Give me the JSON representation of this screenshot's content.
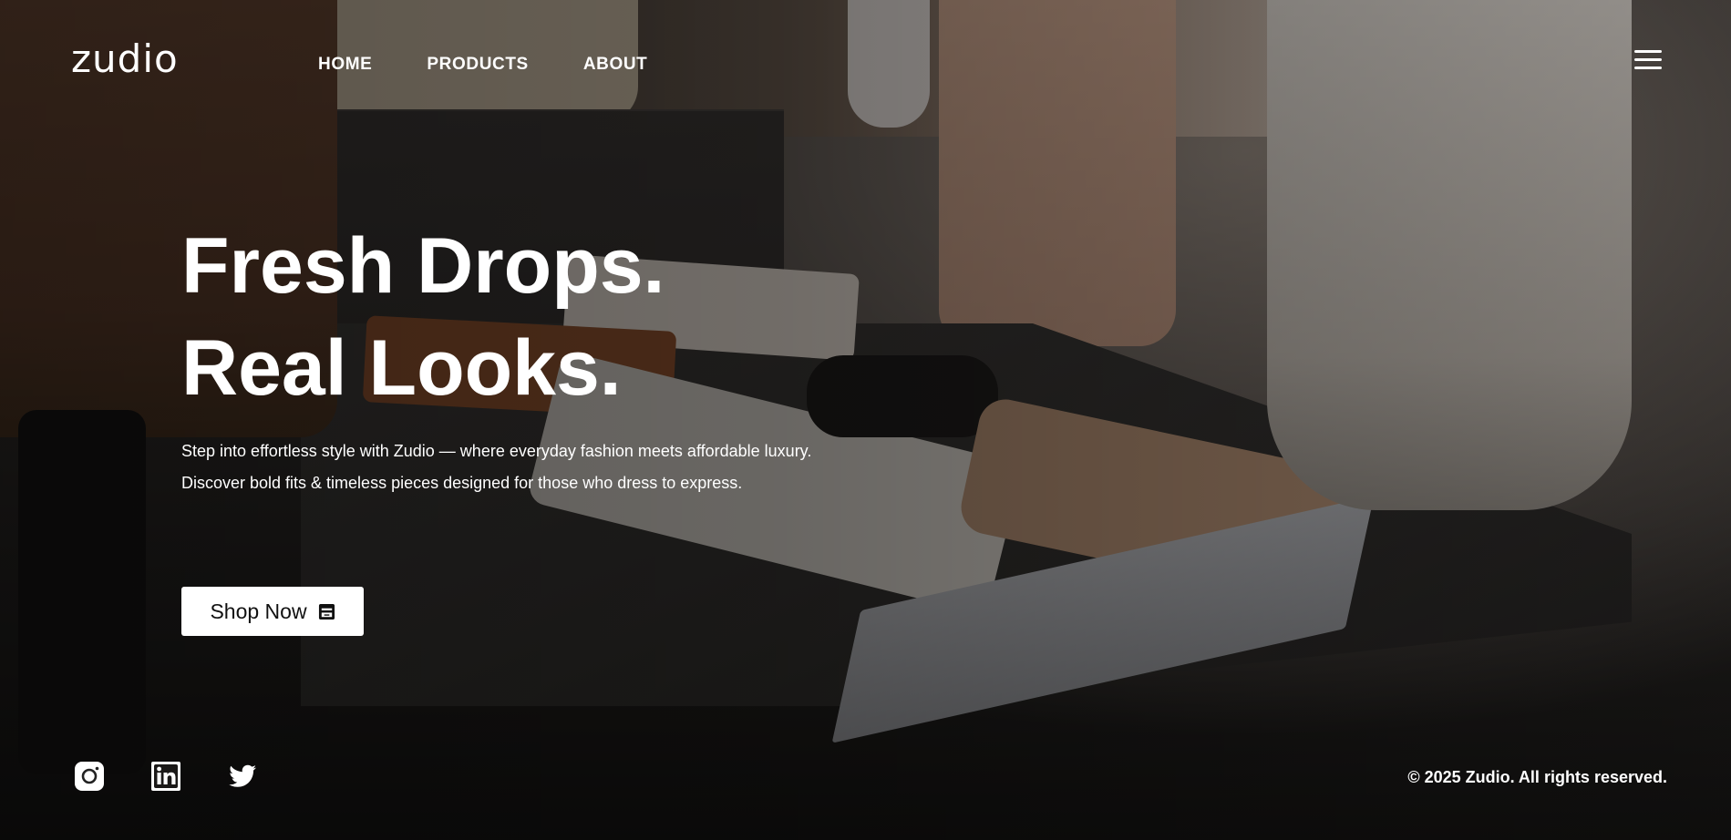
{
  "brand": {
    "logo": "zudio"
  },
  "nav": {
    "items": [
      {
        "label": "HOME"
      },
      {
        "label": "PRODUCTS"
      },
      {
        "label": "ABOUT"
      }
    ],
    "menu_icon": "hamburger-menu-icon"
  },
  "hero": {
    "headline_line1": "Fresh Drops.",
    "headline_line2": "Real Looks.",
    "tagline_line1": "Step into effortless style with Zudio — where everyday fashion meets affordable luxury.",
    "tagline_line2": "Discover bold fits & timeless pieces designed for those who dress to express.",
    "cta_label": "Shop Now",
    "cta_icon": "store-icon"
  },
  "footer": {
    "socials": [
      {
        "icon": "instagram-icon"
      },
      {
        "icon": "linkedin-icon"
      },
      {
        "icon": "twitter-icon"
      }
    ],
    "copyright": "© 2025 Zudio. All rights reserved."
  },
  "colors": {
    "text": "#ffffff",
    "button_bg": "#ffffff",
    "button_text": "#111111"
  }
}
